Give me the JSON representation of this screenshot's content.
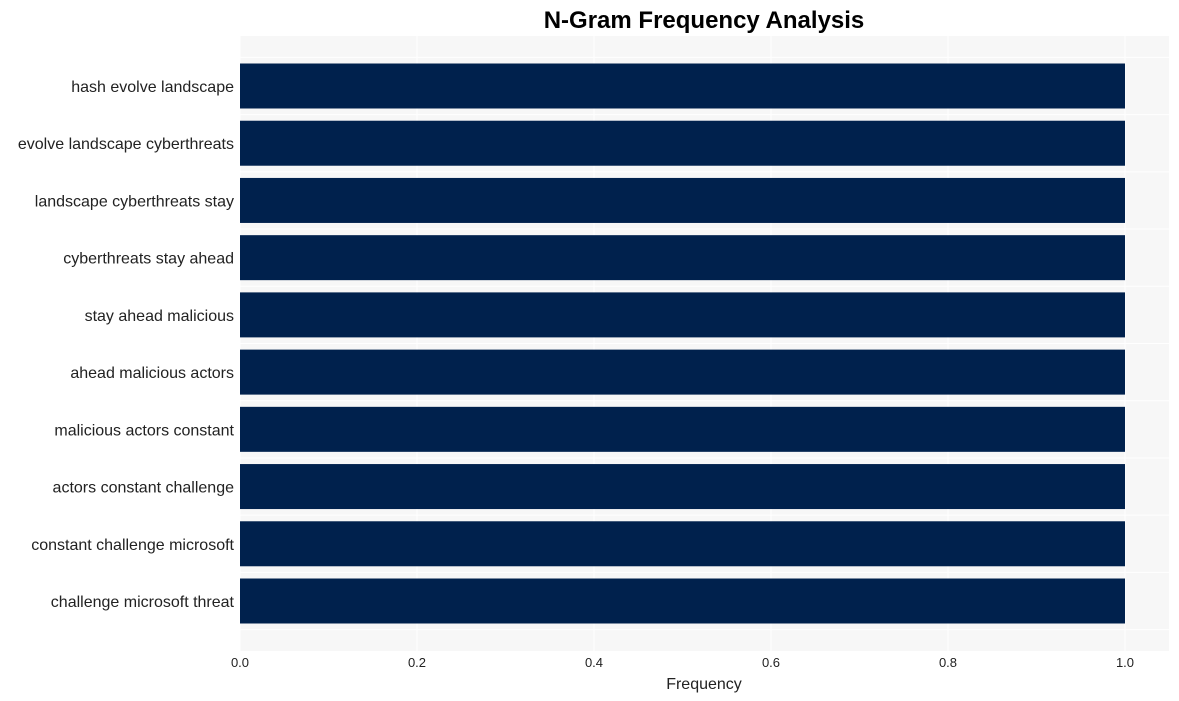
{
  "chart_data": {
    "type": "bar",
    "orientation": "horizontal",
    "title": "N-Gram Frequency Analysis",
    "xlabel": "Frequency",
    "ylabel": "",
    "categories": [
      "hash evolve landscape",
      "evolve landscape cyberthreats",
      "landscape cyberthreats stay",
      "cyberthreats stay ahead",
      "stay ahead malicious",
      "ahead malicious actors",
      "malicious actors constant",
      "actors constant challenge",
      "constant challenge microsoft",
      "challenge microsoft threat"
    ],
    "values": [
      1,
      1,
      1,
      1,
      1,
      1,
      1,
      1,
      1,
      1
    ],
    "xlim": [
      0,
      1.05
    ],
    "xticks": [
      0.0,
      0.2,
      0.4,
      0.6,
      0.8,
      1.0
    ],
    "xtick_labels": [
      "0.0",
      "0.2",
      "0.4",
      "0.6",
      "0.8",
      "1.0"
    ],
    "grid": true,
    "legend": "none",
    "colors": {
      "bar": "#00214d",
      "plot_background": "#f7f7f7",
      "grid": "#ffffff"
    }
  }
}
